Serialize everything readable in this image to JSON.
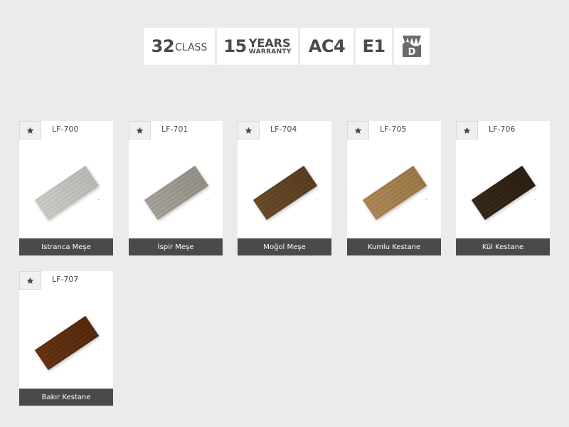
{
  "badges": {
    "class_number": "32",
    "class_label": "CLASS",
    "years_number": "15",
    "years_label": "YEARS",
    "warranty_label": "WARRANTY",
    "ac_rating": "AC4",
    "emission": "E1",
    "d_icon_letter": "D"
  },
  "products": [
    {
      "code": "LF-700",
      "name": "Istranca Meşe",
      "color_a": "#e6e6e3",
      "color_b": "#d4d4d0"
    },
    {
      "code": "LF-701",
      "name": "İspir Meşe",
      "color_a": "#d2cfca",
      "color_b": "#bcb8b2"
    },
    {
      "code": "LF-704",
      "name": "Moğol Meşe",
      "color_a": "#a98f6c",
      "color_b": "#8f7656"
    },
    {
      "code": "LF-705",
      "name": "Kumlu Kestane",
      "color_a": "#d5be98",
      "color_b": "#c1a881"
    },
    {
      "code": "LF-706",
      "name": "Kül Kestane",
      "color_a": "#7c6b55",
      "color_b": "#62523f"
    },
    {
      "code": "LF-707",
      "name": "Bakır Kestane",
      "color_a": "#a67848",
      "color_b": "#8b5f34"
    }
  ]
}
